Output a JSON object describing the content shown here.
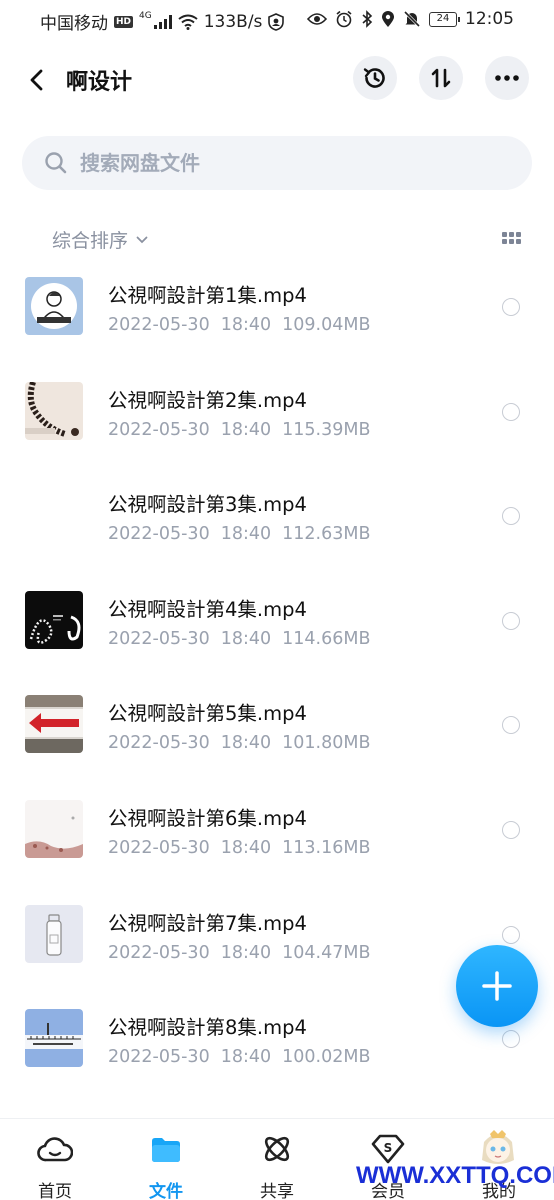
{
  "status_bar": {
    "carrier": "中国移动",
    "hd": "HD",
    "net": "4G",
    "speed": "133B/s",
    "battery": "24",
    "time": "12:05"
  },
  "header": {
    "title": "啊设计"
  },
  "search": {
    "placeholder": "搜索网盘文件"
  },
  "sort": {
    "label": "综合排序"
  },
  "files": [
    {
      "name": "公視啊設計第1集.mp4",
      "date": "2022-05-30",
      "time": "18:40",
      "size": "109.04MB"
    },
    {
      "name": "公視啊設計第2集.mp4",
      "date": "2022-05-30",
      "time": "18:40",
      "size": "115.39MB"
    },
    {
      "name": "公視啊設計第3集.mp4",
      "date": "2022-05-30",
      "time": "18:40",
      "size": "112.63MB"
    },
    {
      "name": "公視啊設計第4集.mp4",
      "date": "2022-05-30",
      "time": "18:40",
      "size": "114.66MB"
    },
    {
      "name": "公視啊設計第5集.mp4",
      "date": "2022-05-30",
      "time": "18:40",
      "size": "101.80MB"
    },
    {
      "name": "公視啊設計第6集.mp4",
      "date": "2022-05-30",
      "time": "18:40",
      "size": "113.16MB"
    },
    {
      "name": "公視啊設計第7集.mp4",
      "date": "2022-05-30",
      "time": "18:40",
      "size": "104.47MB"
    },
    {
      "name": "公視啊設計第8集.mp4",
      "date": "2022-05-30",
      "time": "18:40",
      "size": "100.02MB"
    }
  ],
  "nav": {
    "home": "首页",
    "files": "文件",
    "share": "共享",
    "member": "会员",
    "me": "我的"
  },
  "watermark": "WWW.XXTTQ.COM",
  "colors": {
    "accent": "#1296f0",
    "fab": "#0a95f5",
    "watermark": "#1a2fd6"
  }
}
